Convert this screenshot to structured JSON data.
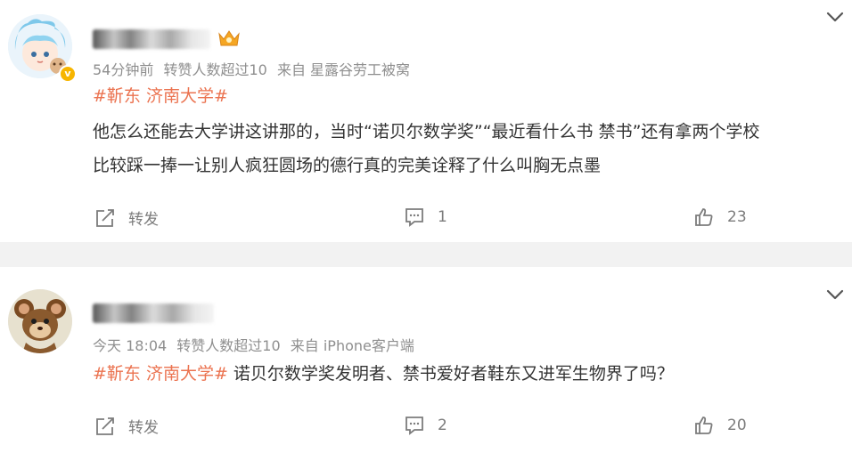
{
  "comments": [
    {
      "username": "",
      "time": "54分钟前",
      "reposts_note": "转赞人数超过10",
      "source": "来自 星露谷劳工被窝",
      "topic": "#靳东 济南大学#",
      "content_line1": "他怎么还能去大学讲这讲那的，当时“诺贝尔数学奖”“最近看什么书 禁书”还有拿两个学校",
      "content_line2": "比较踩一捧一让别人疯狂圆场的德行真的完美诠释了什么叫胸无点墨",
      "repost_label": "转发",
      "comment_count": "1",
      "like_count": "23"
    },
    {
      "username": "",
      "time": "今天 18:04",
      "reposts_note": "转赞人数超过10",
      "source": "来自 iPhone客户端",
      "topic": "#靳东 济南大学#",
      "content_text": " 诺贝尔数学奖发明者、禁书爱好者鞋东又进军生物界了吗？",
      "repost_label": "转发",
      "comment_count": "2",
      "like_count": "20"
    }
  ],
  "colors": {
    "topic": "#eb7350",
    "meta": "#8f8f8f",
    "text": "#333333",
    "divider": "#f2f2f2"
  }
}
